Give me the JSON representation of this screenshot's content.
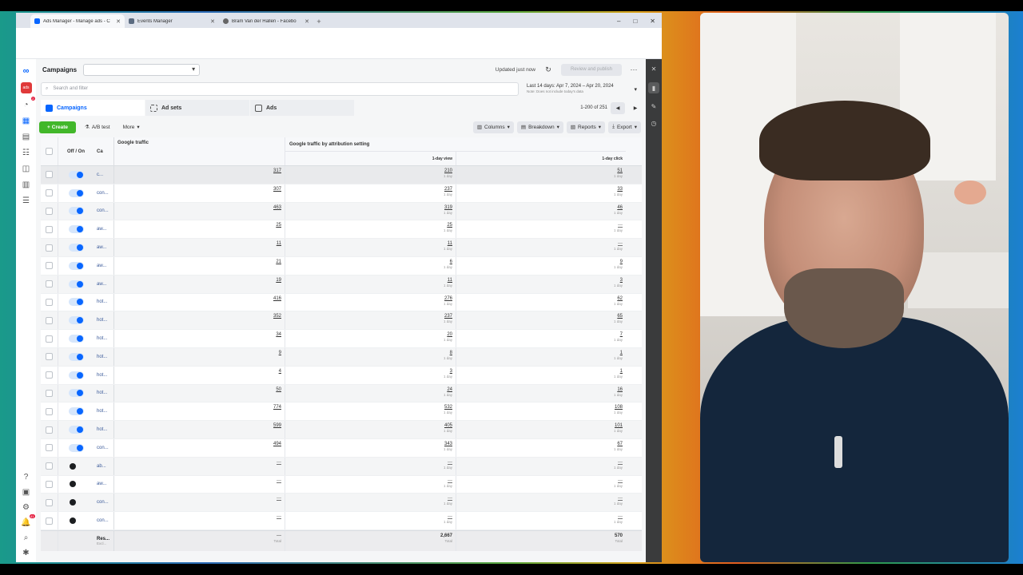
{
  "browser": {
    "tabs": [
      {
        "label": "Ads Manager - Manage ads - C",
        "active": true,
        "icon": "meta-icon"
      },
      {
        "label": "Events Manager",
        "active": false,
        "icon": "events-icon"
      },
      {
        "label": "Bram Van der Hallen - Facebo",
        "active": false,
        "icon": "facebook-icon"
      }
    ],
    "new_tab": "+",
    "controls": {
      "minimize": "–",
      "maximize": "□",
      "close": "✕"
    }
  },
  "leftnav": {
    "account_initials": "ads",
    "badge_notifications": "2",
    "badge_alerts": "41"
  },
  "header": {
    "title": "Campaigns",
    "updated": "Updated just now",
    "review_button": "Review and publish",
    "more": "···"
  },
  "search": {
    "placeholder": "Search and filter",
    "date_range": "Last 14 days: Apr 7, 2024 – Apr 20, 2024",
    "date_note": "Note: Does not include today's data"
  },
  "level_tabs": [
    {
      "label": "Campaigns",
      "active": true
    },
    {
      "label": "Ad sets",
      "active": false
    },
    {
      "label": "Ads",
      "active": false
    }
  ],
  "pager": {
    "text": "1-200 of 251",
    "prev": "◀",
    "next": "▶"
  },
  "toolbar": {
    "create": "Create",
    "ab_test": "A/B test",
    "more": "More",
    "columns": "Columns",
    "breakdown": "Breakdown",
    "reports": "Reports",
    "export": "Export"
  },
  "table": {
    "headers": {
      "off_on": "Off / On",
      "campaign": "Ca",
      "google_traffic": "Google traffic",
      "group": "Google traffic by attribution setting",
      "view": "1-day view",
      "click": "1-day click"
    },
    "rows": [
      {
        "name": "c...",
        "on": true,
        "gt": "317",
        "view": "210",
        "click": "51",
        "first": true
      },
      {
        "name": "con...",
        "on": true,
        "gt": "307",
        "view": "237",
        "click": "33"
      },
      {
        "name": "con...",
        "on": true,
        "gt": "463",
        "view": "319",
        "click": "46"
      },
      {
        "name": "aw...",
        "on": true,
        "gt": "25",
        "view": "25",
        "click": "—"
      },
      {
        "name": "aw...",
        "on": true,
        "gt": "11",
        "view": "11",
        "click": "—"
      },
      {
        "name": "aw...",
        "on": true,
        "gt": "21",
        "view": "6",
        "click": "9"
      },
      {
        "name": "aw...",
        "on": true,
        "gt": "19",
        "view": "11",
        "click": "3"
      },
      {
        "name": "hot...",
        "on": true,
        "gt": "416",
        "view": "276",
        "click": "62"
      },
      {
        "name": "hot...",
        "on": true,
        "gt": "352",
        "view": "237",
        "click": "65"
      },
      {
        "name": "hot...",
        "on": true,
        "gt": "34",
        "view": "20",
        "click": "7"
      },
      {
        "name": "hot...",
        "on": true,
        "gt": "9",
        "view": "8",
        "click": "1"
      },
      {
        "name": "hot...",
        "on": true,
        "gt": "4",
        "view": "3",
        "click": "1"
      },
      {
        "name": "hot...",
        "on": true,
        "gt": "50",
        "view": "24",
        "click": "16"
      },
      {
        "name": "hot...",
        "on": true,
        "gt": "774",
        "view": "532",
        "click": "108"
      },
      {
        "name": "hot...",
        "on": true,
        "gt": "599",
        "view": "405",
        "click": "101"
      },
      {
        "name": "con...",
        "on": true,
        "gt": "494",
        "view": "343",
        "click": "67"
      },
      {
        "name": "ab...",
        "on": false,
        "gt": "—",
        "view": "—",
        "click": "—"
      },
      {
        "name": "aw...",
        "on": false,
        "gt": "—",
        "view": "—",
        "click": "—"
      },
      {
        "name": "con...",
        "on": false,
        "gt": "—",
        "view": "—",
        "click": "—"
      },
      {
        "name": "con...",
        "on": false,
        "gt": "—",
        "view": "—",
        "click": "—"
      }
    ],
    "sub_label": "1 day",
    "totals": {
      "name": "Res...",
      "name_sub": "Excl...",
      "gt": "—",
      "view": "2,667",
      "click": "570",
      "sub": "Total"
    }
  }
}
